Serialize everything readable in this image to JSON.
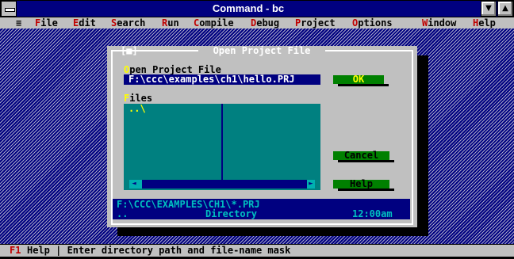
{
  "window": {
    "title": "Command - bc",
    "minimize_glyph": "▼",
    "maximize_glyph": "▲"
  },
  "menu": {
    "system": "≡",
    "items": [
      {
        "hotkey": "F",
        "rest": "ile"
      },
      {
        "hotkey": "E",
        "rest": "dit"
      },
      {
        "hotkey": "S",
        "rest": "earch"
      },
      {
        "hotkey": "R",
        "rest": "un"
      },
      {
        "hotkey": "C",
        "rest": "ompile"
      },
      {
        "hotkey": "D",
        "rest": "ebug"
      },
      {
        "hotkey": "P",
        "rest": "roject"
      },
      {
        "hotkey": "O",
        "rest": "ptions"
      },
      {
        "hotkey": "W",
        "rest": "indow"
      },
      {
        "hotkey": "H",
        "rest": "elp"
      }
    ]
  },
  "dialog": {
    "title": "Open Project File",
    "close_glyph": "[■]",
    "open_label": {
      "hotkey": "O",
      "rest": "pen Project File"
    },
    "path_value": "F:\\ccc\\examples\\ch1\\hello.PRJ",
    "files_label": {
      "hotkey": "F",
      "rest": "iles"
    },
    "files": [
      "..\\"
    ],
    "scroll_left": "◄",
    "scroll_right": "►",
    "ok_label": "OK",
    "cancel_label": {
      "hotkey": "C",
      "rest": "ancel"
    },
    "help_label": {
      "hotkey": "H",
      "rest": "elp"
    },
    "info_path": "F:\\CCC\\EXAMPLES\\CH1\\*.PRJ",
    "info_name": "..",
    "info_type": "Directory",
    "info_time": "12:00am"
  },
  "status": {
    "key": "F1",
    "text": "Help | Enter directory path and file-name mask"
  },
  "colors": {
    "title_bar": "#000080",
    "menu_bg": "#c0c0c0",
    "hotkey_red": "#c00000",
    "dialog_bg": "#c0c0c0",
    "input_bg": "#000080",
    "list_bg": "#008080",
    "button_green": "#008000",
    "ok_text": "#ffff00"
  }
}
